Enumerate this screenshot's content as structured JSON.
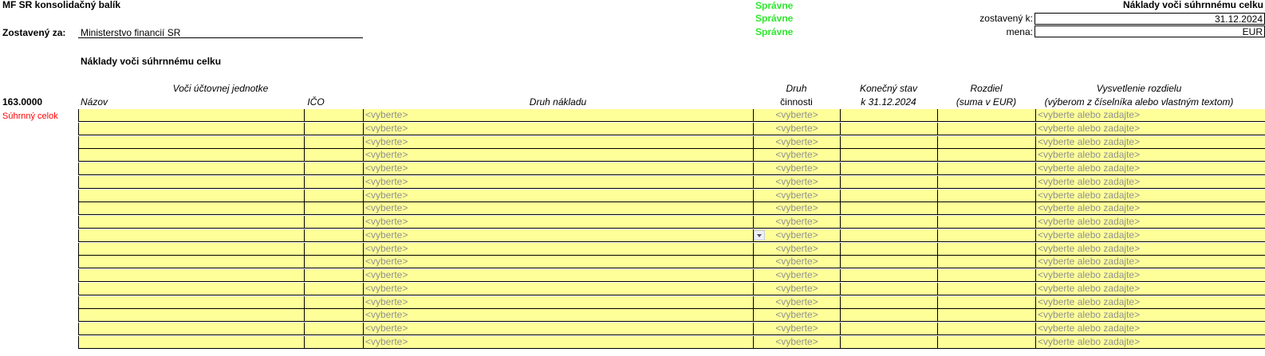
{
  "header": {
    "title": "MF SR konsolidačný balík",
    "zostaveny_za_label": "Zostavený za:",
    "zostaveny_za_value": "Ministerstvo financií SR",
    "status": [
      "Správne",
      "Správne",
      "Správne"
    ],
    "report_title": "Náklady voči súhrnnému celku",
    "zostaveny_k_label": "zostavený k:",
    "zostaveny_k_value": "31.12.2024",
    "mena_label": "mena:",
    "mena_value": "EUR"
  },
  "section_title": "Náklady voči súhrnnému celku",
  "table": {
    "code": "163.0000",
    "group_label": "Voči účtovnej jednotke",
    "columns": {
      "nazov": "Názov",
      "ico": "IČO",
      "druh_nakladu": "Druh nákladu",
      "druh_cinnosti_1": "Druh",
      "druh_cinnosti_2": "činnosti",
      "konecny_stav_1": "Konečný stav",
      "konecny_stav_2": "k 31.12.2024",
      "rozdiel_1": "Rozdiel",
      "rozdiel_2": "(suma v EUR)",
      "vysvetlenie_1": "Vysvetlenie rozdielu",
      "vysvetlenie_2": "(výberom z číselníka alebo vlastným textom)"
    },
    "row_label": "Súhrnný celok",
    "placeholder_select": "<vyberte>",
    "placeholder_select_or_type": "<vyberte alebo zadajte>",
    "row_count": 18,
    "active_dropdown_row": 9
  },
  "colors": {
    "status_ok": "#2ee82e",
    "input_fill": "#ffff99",
    "label_red": "#ff0000",
    "placeholder_gray": "#8f8f8f"
  }
}
